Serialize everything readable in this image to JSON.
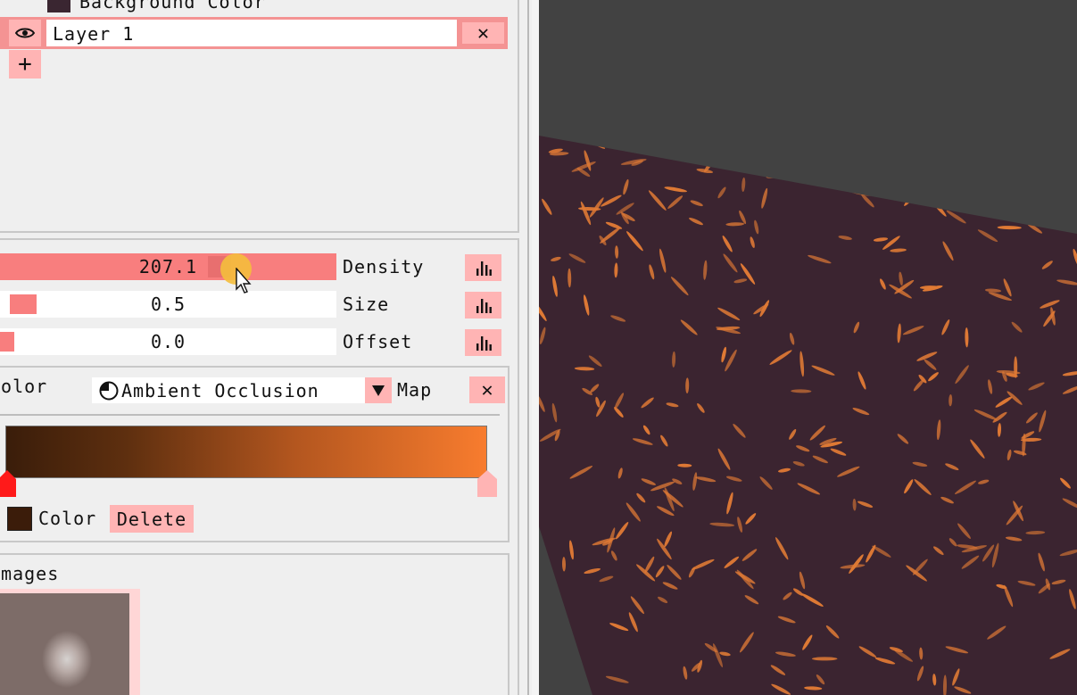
{
  "layers": {
    "background_label": "Background Color",
    "background_swatch": "#3a2631",
    "layer_name": "Layer 1",
    "add_symbol": "+",
    "delete_symbol": "✕"
  },
  "params": {
    "density": {
      "label": "Density",
      "value": "207.1",
      "fraction": 0.55
    },
    "size": {
      "label": "Size",
      "value": "0.5",
      "fraction": 0.08
    },
    "offset": {
      "label": "Offset",
      "value": "0.0",
      "fraction": 0.04
    }
  },
  "color_map": {
    "label": "Color",
    "source": "Ambient Occlusion",
    "map_label": "Map",
    "close_symbol": "✕",
    "gradient_start": "#3a1d0a",
    "gradient_end": "#f87c2e",
    "stop_color": "#3b1c0a",
    "stop_label": "Color",
    "delete_label": "Delete"
  },
  "images": {
    "label": "Images"
  },
  "colors": {
    "accent": "#f87e7e",
    "button": "#ffb4b4",
    "viewport_bg": "#424242",
    "surface": "#3b2430",
    "particle": "#e07a35"
  }
}
